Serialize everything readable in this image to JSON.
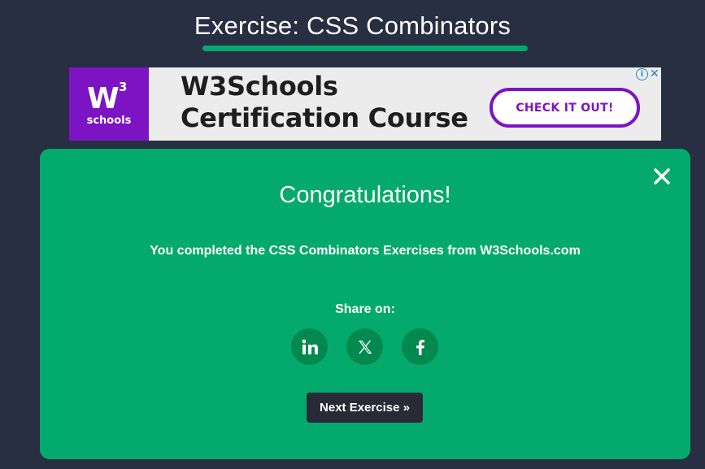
{
  "page": {
    "title": "Exercise: CSS Combinators"
  },
  "ad": {
    "logo_sup": "3",
    "logo_w": "W",
    "logo_schools": "schools",
    "headline_line1": "W3Schools",
    "headline_line2": "Certification Course",
    "cta_label": "CHECK IT OUT!",
    "info_glyph": "i",
    "close_glyph": "✕"
  },
  "modal": {
    "heading": "Congratulations!",
    "message": "You completed the CSS Combinators Exercises from W3Schools.com",
    "share_label": "Share on:",
    "share_buttons": [
      {
        "name": "linkedin",
        "glyph": "in"
      },
      {
        "name": "x",
        "glyph": "𝕏"
      },
      {
        "name": "facebook",
        "glyph": "f"
      }
    ],
    "next_label": "Next Exercise »"
  },
  "colors": {
    "background": "#282f42",
    "accent_green": "#04aa6d",
    "share_circle": "#03894f",
    "brand_purple": "#7c14c4",
    "next_button": "#282a35"
  }
}
